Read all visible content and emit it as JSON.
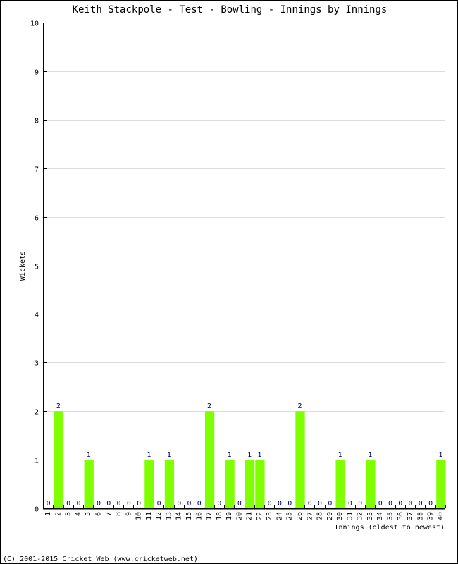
{
  "chart_data": {
    "type": "bar",
    "title": "Keith Stackpole - Test - Bowling - Innings by Innings",
    "xlabel": "Innings (oldest to newest)",
    "ylabel": "Wickets",
    "ylim": [
      0,
      10
    ],
    "yticks": [
      0,
      1,
      2,
      3,
      4,
      5,
      6,
      7,
      8,
      9,
      10
    ],
    "grid": true,
    "categories": [
      "1",
      "2",
      "3",
      "4",
      "5",
      "6",
      "7",
      "8",
      "9",
      "10",
      "11",
      "12",
      "13",
      "14",
      "15",
      "16",
      "17",
      "18",
      "19",
      "20",
      "21",
      "22",
      "23",
      "24",
      "25",
      "26",
      "27",
      "28",
      "29",
      "30",
      "31",
      "32",
      "33",
      "34",
      "35",
      "36",
      "37",
      "38",
      "39",
      "40"
    ],
    "values": [
      0,
      2,
      0,
      0,
      1,
      0,
      0,
      0,
      0,
      0,
      1,
      0,
      1,
      0,
      0,
      0,
      2,
      0,
      1,
      0,
      1,
      1,
      0,
      0,
      0,
      2,
      0,
      0,
      0,
      1,
      0,
      0,
      1,
      0,
      0,
      0,
      0,
      0,
      0,
      1
    ],
    "bar_color": "#80ff00",
    "label_color": "#000080",
    "grid_color": "#dcdcdc"
  },
  "footer": "(C) 2001-2015 Cricket Web (www.cricketweb.net)"
}
